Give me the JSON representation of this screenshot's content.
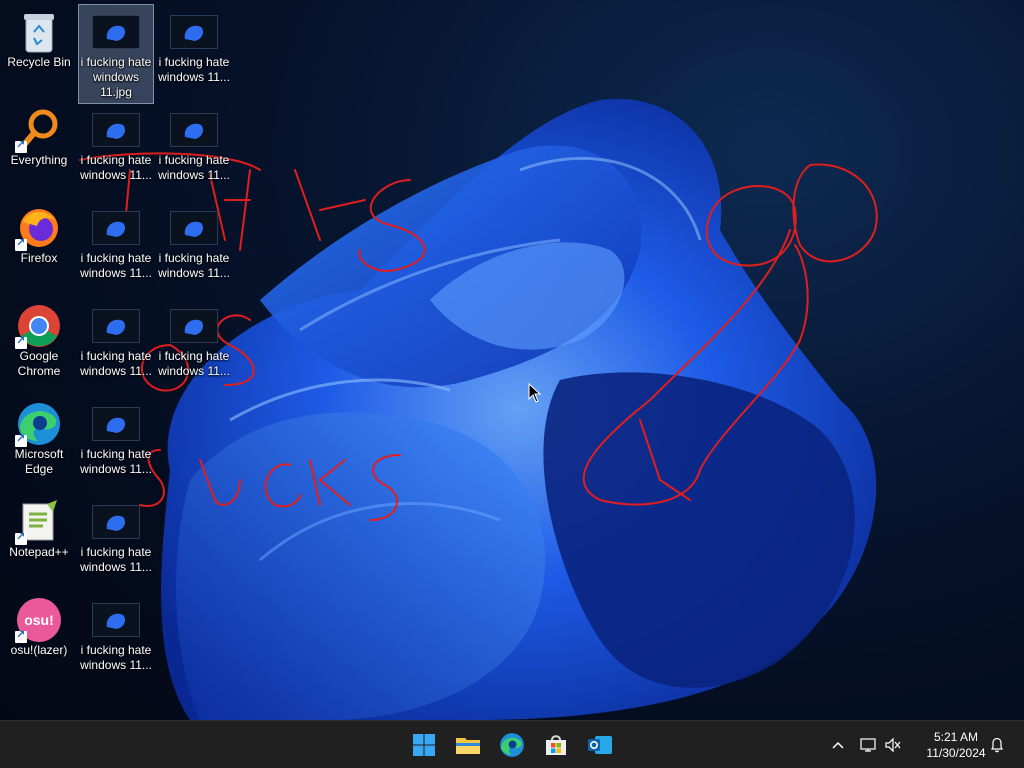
{
  "desktop_icons": [
    {
      "label": "Recycle Bin"
    },
    {
      "label": "Everything"
    },
    {
      "label": "Firefox"
    },
    {
      "label": "Google\nChrome"
    },
    {
      "label": "Microsoft\nEdge"
    },
    {
      "label": "Notepad++"
    },
    {
      "label": "osu!(lazer)",
      "badge": "osu!"
    }
  ],
  "files": [
    {
      "label": "i fucking hate\nwindows\n11.jpg"
    },
    {
      "label": "i fucking hate\nwindows 11..."
    },
    {
      "label": "i fucking hate\nwindows 11..."
    },
    {
      "label": "i fucking hate\nwindows 11..."
    },
    {
      "label": "i fucking hate\nwindows 11..."
    },
    {
      "label": "i fucking hate\nwindows 11..."
    },
    {
      "label": "i fucking hate\nwindows 11..."
    },
    {
      "label": "i fucking hate\nwindows 11..."
    },
    {
      "label": "i fucking hate\nwindows 11..."
    },
    {
      "label": "i fucking hate\nwindows 11..."
    },
    {
      "label": "i fucking hate\nwindows 11..."
    }
  ],
  "taskbar": {
    "apps": [
      "start-button",
      "file-explorer",
      "microsoft-edge",
      "microsoft-store",
      "outlook"
    ],
    "clock": {
      "time": "5:21 AM",
      "date": "11/30/2024"
    },
    "tray_icons": [
      "chevron-up-icon",
      "network-icon",
      "volume-muted-icon",
      "notification-bell-icon"
    ]
  },
  "colors": {
    "accent": "#1f6feb",
    "scribble": "#e01e1e",
    "taskbar": "#202020"
  }
}
